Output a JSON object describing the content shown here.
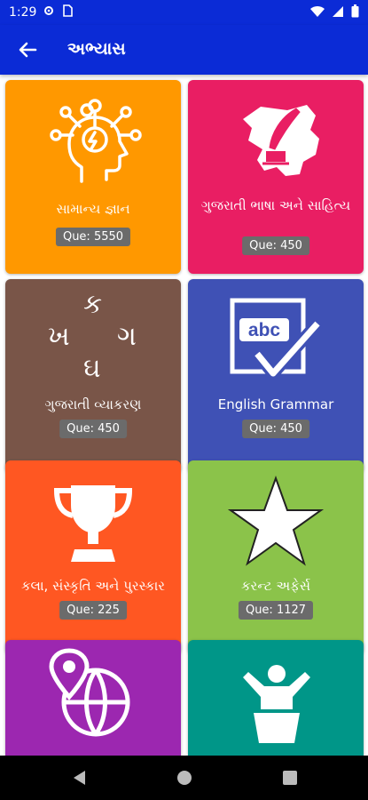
{
  "status": {
    "time": "1:29"
  },
  "appbar": {
    "title": "અભ્યાસ"
  },
  "cards": [
    {
      "label": "સામાન્ય જ્ઞાન",
      "count": "Que: 5550",
      "color": "#ff9800",
      "icon": "head-lightbulb-icon"
    },
    {
      "label": "ગુજરાતી ભાષા અને સાહિત્ય",
      "count": "Que: 450",
      "color": "#e91e63",
      "icon": "gujarat-map-quill-icon"
    },
    {
      "label": "ગુજરાતી વ્યાકરણ",
      "count": "Que: 450",
      "color": "#795548",
      "icon": "gujarati-letters-icon",
      "letters": {
        "top": "ક",
        "left": "ખ",
        "right": "ગ",
        "bottom": "ઘ"
      }
    },
    {
      "label": "English Grammar",
      "count": "Que: 450",
      "color": "#3f51b5",
      "icon": "abc-check-icon",
      "icon_text": "abc"
    },
    {
      "label": "કલા, સંસ્કૃતિ અને પુરસ્કાર",
      "count": "Que: 225",
      "color": "#ff5722",
      "icon": "trophy-icon"
    },
    {
      "label": "કરન્ટ અફેર્સ",
      "count": "Que: 1127",
      "color": "#8bc34a",
      "icon": "star-icon"
    },
    {
      "label": "",
      "count": "",
      "color": "#9c27b0",
      "icon": "globe-pin-icon"
    },
    {
      "label": "",
      "count": "",
      "color": "#009688",
      "icon": "speaker-podium-icon"
    }
  ],
  "colors": {
    "primary": "#0b2bd6",
    "badge": "#6b6b6b"
  }
}
